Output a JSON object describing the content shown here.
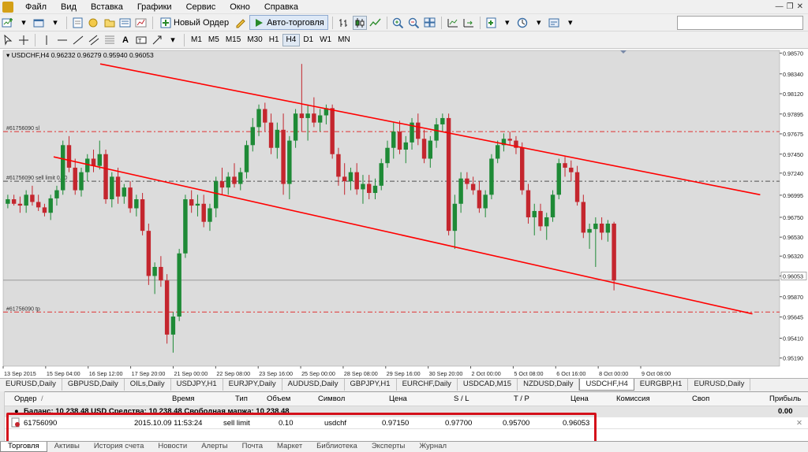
{
  "menu": [
    "Файл",
    "Вид",
    "Вставка",
    "Графики",
    "Сервис",
    "Окно",
    "Справка"
  ],
  "toolbar": {
    "new_order": "Новый Ордер",
    "auto_trading": "Авто-торговля"
  },
  "timeframes": [
    "M1",
    "M5",
    "M15",
    "M30",
    "H1",
    "H4",
    "D1",
    "W1",
    "MN"
  ],
  "active_timeframe": "H4",
  "chart": {
    "header": "USDCHF,H4  0.96232 0.96279 0.95940 0.96053",
    "current_price": "0.96053",
    "levels": {
      "sl": "#61756090 sl",
      "sell_limit": "#61756090 sell limit 0.10",
      "tp": "#61756090 tp"
    },
    "colors": {
      "bull": "#1e8a36",
      "bear": "#c4262e",
      "channel": "#ff0000",
      "bg": "#ffffff"
    }
  },
  "chart_data": {
    "type": "candlestick",
    "symbol": "USDCHF",
    "timeframe": "H4",
    "ohlc_header": {
      "open": 0.96232,
      "high": 0.96279,
      "low": 0.9594,
      "close": 0.96053
    },
    "y_ticks": [
      0.9519,
      0.9541,
      0.95645,
      0.9587,
      0.961,
      0.9632,
      0.9653,
      0.9675,
      0.96995,
      0.9724,
      0.9745,
      0.97675,
      0.97895,
      0.9812,
      0.9834,
      0.9857
    ],
    "y_tick_labels": [
      "0.95190",
      "0.95410",
      "0.95645",
      "0.95870",
      "0.96053",
      "0.96320",
      "0.96530",
      "0.96750",
      "0.96995",
      "0.97240",
      "0.97450",
      "0.97675",
      "0.97895",
      "0.98120",
      "0.98340",
      "0.98570"
    ],
    "ylim": [
      0.951,
      0.986
    ],
    "x_labels": [
      "13 Sep 2015",
      "15 Sep 04:00",
      "16 Sep 12:00",
      "17 Sep 20:00",
      "21 Sep 00:00",
      "22 Sep 08:00",
      "23 Sep 16:00",
      "25 Sep 00:00",
      "28 Sep 08:00",
      "29 Sep 16:00",
      "30 Sep 20:00",
      "2 Oct 00:00",
      "5 Oct 08:00",
      "6 Oct 16:00",
      "8 Oct 00:00",
      "9 Oct 08:00"
    ],
    "levels": [
      {
        "name": "sl",
        "price": 0.977
      },
      {
        "name": "sell limit",
        "price": 0.9715
      },
      {
        "name": "tp",
        "price": 0.957
      },
      {
        "name": "bid",
        "price": 0.96053
      }
    ],
    "channel": {
      "upper": [
        [
          0.125,
          0.9845
        ],
        [
          0.975,
          0.97
        ]
      ],
      "lower": [
        [
          0.065,
          0.9742
        ],
        [
          0.965,
          0.9568
        ]
      ]
    },
    "candles": [
      [
        0.969,
        0.97,
        0.9685,
        0.9695
      ],
      [
        0.9695,
        0.97,
        0.9688,
        0.969
      ],
      [
        0.969,
        0.9698,
        0.968,
        0.9688
      ],
      [
        0.9688,
        0.9705,
        0.968,
        0.97
      ],
      [
        0.97,
        0.971,
        0.9688,
        0.9692
      ],
      [
        0.9692,
        0.97,
        0.9682,
        0.9686
      ],
      [
        0.9686,
        0.969,
        0.9676,
        0.968
      ],
      [
        0.968,
        0.97,
        0.9672,
        0.9696
      ],
      [
        0.9696,
        0.971,
        0.9688,
        0.9705
      ],
      [
        0.9705,
        0.976,
        0.97,
        0.9755
      ],
      [
        0.9755,
        0.9765,
        0.9725,
        0.973
      ],
      [
        0.973,
        0.974,
        0.97,
        0.9705
      ],
      [
        0.9705,
        0.973,
        0.9698,
        0.9725
      ],
      [
        0.9725,
        0.9745,
        0.9715,
        0.974
      ],
      [
        0.974,
        0.975,
        0.9725,
        0.9732
      ],
      [
        0.9732,
        0.976,
        0.9728,
        0.9745
      ],
      [
        0.9745,
        0.975,
        0.969,
        0.9695
      ],
      [
        0.9695,
        0.9725,
        0.9686,
        0.972
      ],
      [
        0.972,
        0.973,
        0.969,
        0.9698
      ],
      [
        0.9698,
        0.9712,
        0.969,
        0.9708
      ],
      [
        0.9708,
        0.9715,
        0.968,
        0.9685
      ],
      [
        0.9685,
        0.97,
        0.9676,
        0.9695
      ],
      [
        0.9695,
        0.9702,
        0.9655,
        0.966
      ],
      [
        0.966,
        0.9668,
        0.96,
        0.961
      ],
      [
        0.961,
        0.9625,
        0.959,
        0.962
      ],
      [
        0.962,
        0.9632,
        0.9598,
        0.9605
      ],
      [
        0.9605,
        0.9612,
        0.9535,
        0.9545
      ],
      [
        0.9545,
        0.957,
        0.9525,
        0.9565
      ],
      [
        0.9565,
        0.964,
        0.956,
        0.9635
      ],
      [
        0.9635,
        0.97,
        0.963,
        0.9695
      ],
      [
        0.9695,
        0.9705,
        0.968,
        0.9688
      ],
      [
        0.9688,
        0.97,
        0.9676,
        0.969
      ],
      [
        0.969,
        0.97,
        0.9664,
        0.967
      ],
      [
        0.967,
        0.969,
        0.966,
        0.9685
      ],
      [
        0.9685,
        0.972,
        0.9675,
        0.9715
      ],
      [
        0.9715,
        0.973,
        0.97,
        0.9708
      ],
      [
        0.9708,
        0.9725,
        0.97,
        0.972
      ],
      [
        0.972,
        0.9735,
        0.9708,
        0.9712
      ],
      [
        0.9712,
        0.973,
        0.9705,
        0.9725
      ],
      [
        0.9725,
        0.976,
        0.9718,
        0.9755
      ],
      [
        0.9755,
        0.9785,
        0.9748,
        0.9775
      ],
      [
        0.9775,
        0.98,
        0.9765,
        0.9795
      ],
      [
        0.9795,
        0.9802,
        0.977,
        0.978
      ],
      [
        0.978,
        0.979,
        0.9745,
        0.9752
      ],
      [
        0.9752,
        0.978,
        0.974,
        0.9772
      ],
      [
        0.9772,
        0.979,
        0.97,
        0.9712
      ],
      [
        0.9712,
        0.9765,
        0.9695,
        0.976
      ],
      [
        0.976,
        0.9795,
        0.9752,
        0.979
      ],
      [
        0.979,
        0.9845,
        0.977,
        0.9785
      ],
      [
        0.9785,
        0.98,
        0.976,
        0.979
      ],
      [
        0.979,
        0.9808,
        0.9775,
        0.978
      ],
      [
        0.978,
        0.9795,
        0.977,
        0.9788
      ],
      [
        0.9788,
        0.98,
        0.9778,
        0.9796
      ],
      [
        0.9796,
        0.98,
        0.974,
        0.9745
      ],
      [
        0.9745,
        0.9752,
        0.971,
        0.972
      ],
      [
        0.972,
        0.9735,
        0.97,
        0.9715
      ],
      [
        0.9715,
        0.973,
        0.9705,
        0.9725
      ],
      [
        0.9725,
        0.9735,
        0.97,
        0.9706
      ],
      [
        0.9706,
        0.9722,
        0.969,
        0.9712
      ],
      [
        0.9712,
        0.9722,
        0.9695,
        0.9702
      ],
      [
        0.9702,
        0.9718,
        0.9695,
        0.971
      ],
      [
        0.971,
        0.974,
        0.9705,
        0.9735
      ],
      [
        0.9735,
        0.976,
        0.973,
        0.9752
      ],
      [
        0.9752,
        0.978,
        0.974,
        0.977
      ],
      [
        0.977,
        0.9782,
        0.9745,
        0.975
      ],
      [
        0.975,
        0.9765,
        0.9735,
        0.9758
      ],
      [
        0.9758,
        0.9785,
        0.975,
        0.978
      ],
      [
        0.978,
        0.979,
        0.9755,
        0.9762
      ],
      [
        0.9762,
        0.9772,
        0.9735,
        0.974
      ],
      [
        0.974,
        0.9765,
        0.973,
        0.976
      ],
      [
        0.976,
        0.9785,
        0.9752,
        0.9778
      ],
      [
        0.9778,
        0.979,
        0.977,
        0.9785
      ],
      [
        0.9785,
        0.979,
        0.9655,
        0.966
      ],
      [
        0.966,
        0.97,
        0.964,
        0.969
      ],
      [
        0.969,
        0.9725,
        0.968,
        0.9718
      ],
      [
        0.9718,
        0.9725,
        0.9706,
        0.9712
      ],
      [
        0.9712,
        0.972,
        0.97,
        0.9705
      ],
      [
        0.9705,
        0.9715,
        0.968,
        0.9685
      ],
      [
        0.9685,
        0.9705,
        0.9675,
        0.97
      ],
      [
        0.97,
        0.9745,
        0.9695,
        0.974
      ],
      [
        0.974,
        0.976,
        0.9735,
        0.9755
      ],
      [
        0.9755,
        0.9768,
        0.9748,
        0.9762
      ],
      [
        0.9762,
        0.977,
        0.9755,
        0.976
      ],
      [
        0.976,
        0.9765,
        0.9745,
        0.9752
      ],
      [
        0.9752,
        0.9758,
        0.97,
        0.9705
      ],
      [
        0.9705,
        0.9712,
        0.9668,
        0.9675
      ],
      [
        0.9675,
        0.969,
        0.9655,
        0.9682
      ],
      [
        0.9682,
        0.969,
        0.966,
        0.9665
      ],
      [
        0.9665,
        0.968,
        0.965,
        0.9675
      ],
      [
        0.9675,
        0.9705,
        0.967,
        0.97
      ],
      [
        0.97,
        0.974,
        0.9695,
        0.9735
      ],
      [
        0.9735,
        0.9742,
        0.972,
        0.973
      ],
      [
        0.973,
        0.9738,
        0.9715,
        0.9725
      ],
      [
        0.9725,
        0.9732,
        0.9688,
        0.9692
      ],
      [
        0.9692,
        0.97,
        0.9652,
        0.9658
      ],
      [
        0.9658,
        0.9668,
        0.964,
        0.9662
      ],
      [
        0.9662,
        0.9675,
        0.962,
        0.9668
      ],
      [
        0.9668,
        0.9675,
        0.965,
        0.9658
      ],
      [
        0.9658,
        0.9672,
        0.9648,
        0.9668
      ],
      [
        0.9668,
        0.967,
        0.9594,
        0.9605
      ]
    ]
  },
  "chart_tabs": [
    "EURUSD,Daily",
    "GBPUSD,Daily",
    "OILs,Daily",
    "USDJPY,H1",
    "EURJPY,Daily",
    "AUDUSD,Daily",
    "GBPJPY,H1",
    "EURCHF,Daily",
    "USDCAD,M15",
    "NZDUSD,Daily",
    "USDCHF,H4",
    "EURGBP,H1",
    "EURUSD,Daily"
  ],
  "active_chart_tab": "USDCHF,H4",
  "terminal": {
    "headers": {
      "order": "Ордер",
      "time": "Время",
      "type": "Тип",
      "volume": "Объем",
      "symbol": "Символ",
      "price": "Цена",
      "sl": "S / L",
      "tp": "T / P",
      "price2": "Цена",
      "commission": "Комиссия",
      "swap": "Своп",
      "profit": "Прибыль"
    },
    "balance": "Баланс: 10 238.48 USD  Средства: 10 238.48  Свободная маржа: 10 238.48",
    "balance_profit": "0.00",
    "order": {
      "id": "61756090",
      "time": "2015.10.09 11:53:24",
      "type": "sell limit",
      "volume": "0.10",
      "symbol": "usdchf",
      "price": "0.97150",
      "sl": "0.97700",
      "tp": "0.95700",
      "current": "0.96053"
    },
    "tabs": [
      "Торговля",
      "Активы",
      "История счета",
      "Новости",
      "Алерты",
      "Почта",
      "Маркет",
      "Библиотека",
      "Эксперты",
      "Журнал"
    ],
    "active_tab": "Торговля"
  }
}
